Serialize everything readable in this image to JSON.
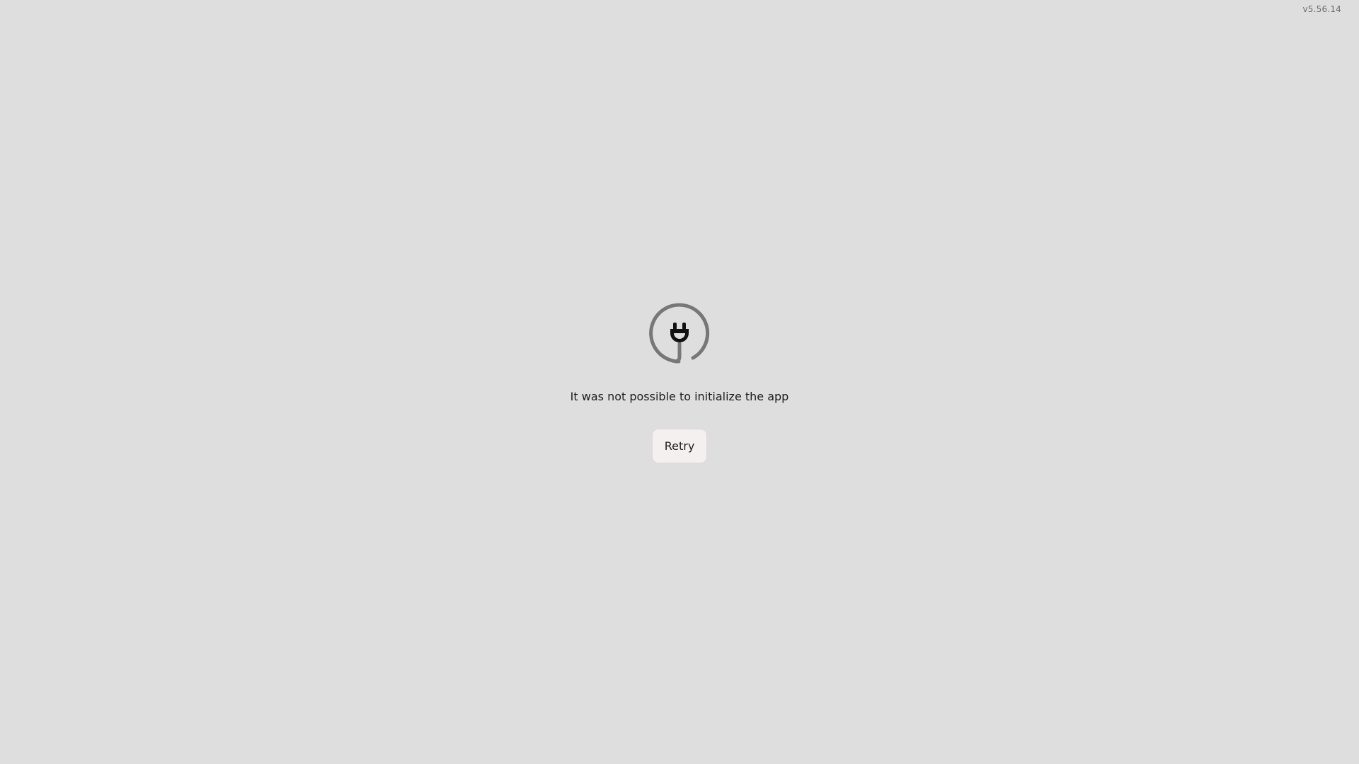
{
  "app": {
    "version": "v5.56.14"
  },
  "error": {
    "icon": "plug-disconnected-icon",
    "message": "It was not possible to initialize the app",
    "retry_label": "Retry"
  },
  "colors": {
    "background": "#dedede",
    "button_bg": "#f4f0ef",
    "icon_ring": "#777777",
    "icon_plug": "#111111",
    "text": "#1c1c1c",
    "version_text": "#6b6b6b"
  }
}
